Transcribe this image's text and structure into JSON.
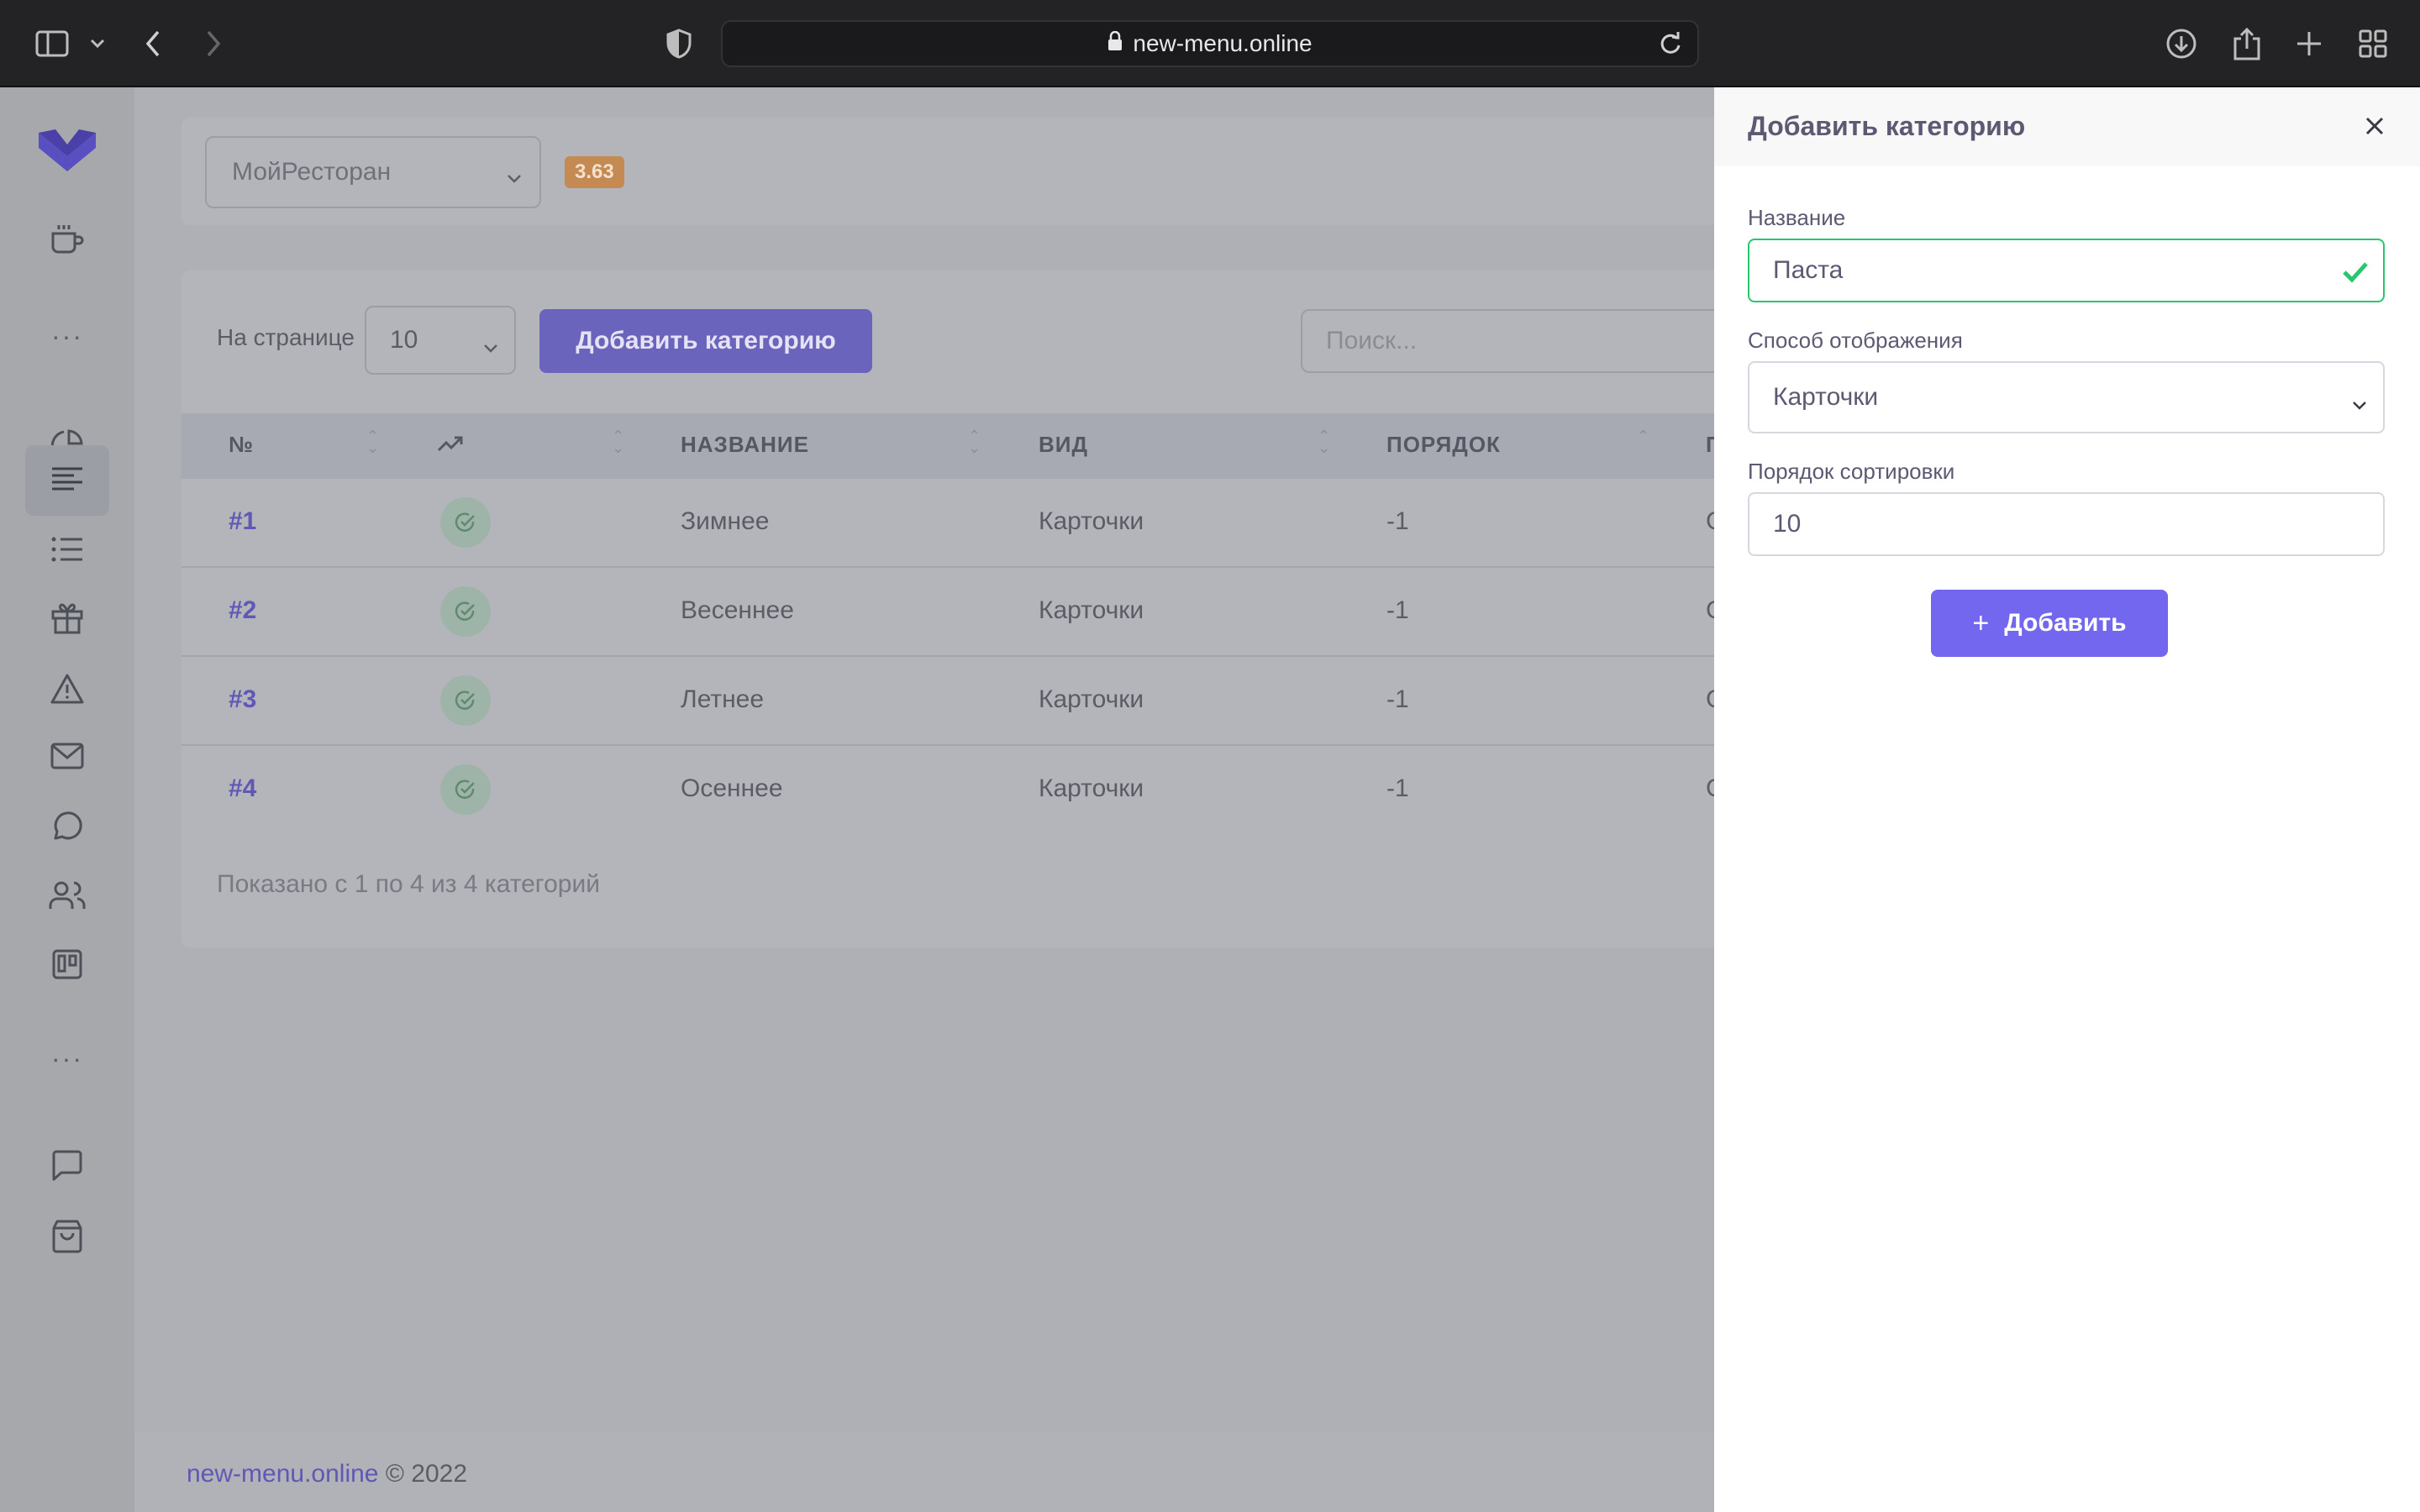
{
  "browser": {
    "url": "new-menu.online"
  },
  "header": {
    "restaurant": "МойРесторан",
    "version": "3.63"
  },
  "toolbar": {
    "per_page_label": "На странице",
    "per_page_value": "10",
    "add_category_label": "Добавить категорию",
    "search_placeholder": "Поиск..."
  },
  "table": {
    "columns": [
      "№",
      "",
      "НАЗВАНИЕ",
      "ВИД",
      "ПОРЯДОК",
      "П"
    ],
    "rows": [
      {
        "id": "#1",
        "name": "Зимнее",
        "view": "Карточки",
        "order": "-1",
        "extra": "С"
      },
      {
        "id": "#2",
        "name": "Весеннее",
        "view": "Карточки",
        "order": "-1",
        "extra": "С"
      },
      {
        "id": "#3",
        "name": "Летнее",
        "view": "Карточки",
        "order": "-1",
        "extra": "С"
      },
      {
        "id": "#4",
        "name": "Осеннее",
        "view": "Карточки",
        "order": "-1",
        "extra": "С"
      }
    ],
    "summary": "Показано с 1 по 4 из 4 категорий"
  },
  "footer": {
    "link": "new-menu.online",
    "copyright": "© 2022"
  },
  "panel": {
    "title": "Добавить категорию",
    "name_label": "Название",
    "name_value": "Паста",
    "display_label": "Способ отображения",
    "display_value": "Карточки",
    "sort_label": "Порядок сортировки",
    "sort_value": "10",
    "submit_label": "Добавить"
  },
  "colors": {
    "accent": "#7367f0",
    "success": "#28c76f",
    "badge": "#ff9f43"
  }
}
